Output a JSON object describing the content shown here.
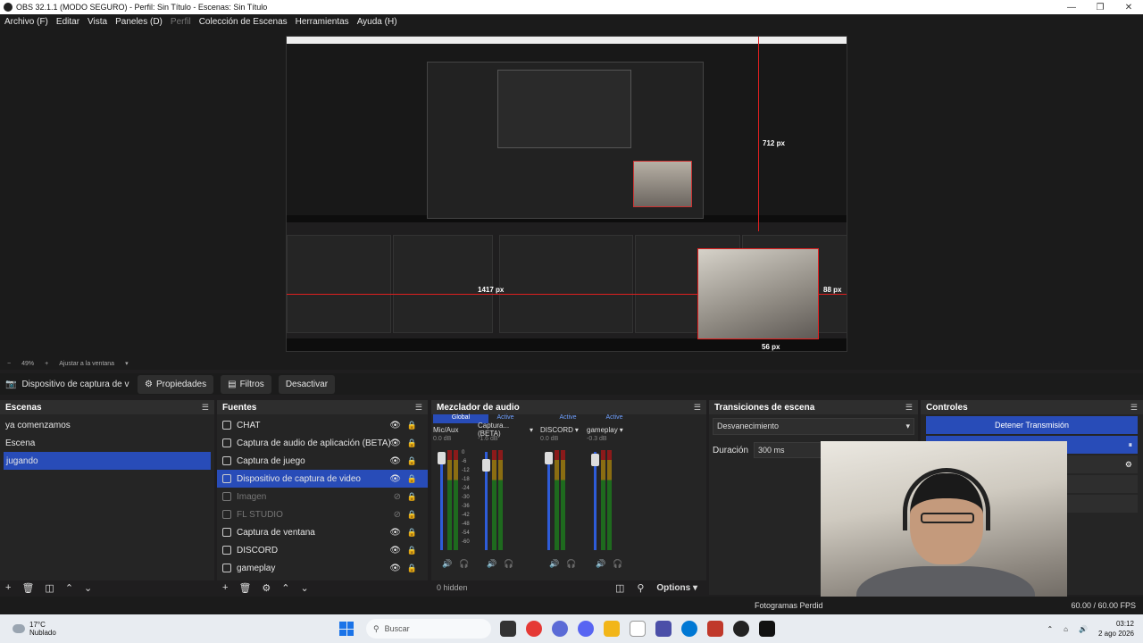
{
  "window": {
    "title": "OBS 32.1.1 (MODO SEGURO) - Perfil: Sin Título - Escenas: Sin Título",
    "minimize": "—",
    "maximize": "❐",
    "close": "✕"
  },
  "menu": [
    "Archivo (F)",
    "Editar",
    "Vista",
    "Paneles (D)",
    "Perfil",
    "Colección de Escenas",
    "Herramientas",
    "Ayuda (H)"
  ],
  "preview": {
    "measure_top": "712 px",
    "measure_left": "1417 px",
    "measure_right": "88 px",
    "measure_bottom": "56 px",
    "zoom": "49%",
    "zoom_fit": "Ajustar a la ventana"
  },
  "source_bar": {
    "selected_source": "Dispositivo de captura de v",
    "properties": "Propiedades",
    "filters": "Filtros",
    "deactivate": "Desactivar"
  },
  "scenes": {
    "title": "Escenas",
    "items": [
      "ya comenzamos",
      "Escena",
      "jugando"
    ],
    "selected_index": 2
  },
  "sources": {
    "title": "Fuentes",
    "items": [
      {
        "label": "CHAT",
        "icon": "globe-icon",
        "hidden": false
      },
      {
        "label": "Captura de audio de aplicación (BETA)",
        "icon": "window-icon",
        "hidden": false
      },
      {
        "label": "Captura de juego",
        "icon": "gamepad-icon",
        "hidden": false
      },
      {
        "label": "Dispositivo de captura de video",
        "icon": "camera-icon",
        "hidden": false
      },
      {
        "label": "Imagen",
        "icon": "image-icon",
        "hidden": true
      },
      {
        "label": "FL STUDIO",
        "icon": "window-icon",
        "hidden": true
      },
      {
        "label": "Captura de ventana",
        "icon": "window-icon",
        "hidden": false
      },
      {
        "label": "DISCORD",
        "icon": "window-icon",
        "hidden": false
      },
      {
        "label": "gameplay",
        "icon": "window-icon",
        "hidden": false
      }
    ],
    "selected_index": 3
  },
  "mixer": {
    "title": "Mezclador de audio",
    "channels": [
      {
        "status": "Global",
        "name": "Mic/Aux",
        "db": "0.0 dB"
      },
      {
        "status": "Active",
        "name": "Captura... (BETA)",
        "db": "-1.6 dB"
      },
      {
        "status": "Active",
        "name": "DISCORD",
        "db": "0.0 dB"
      },
      {
        "status": "Active",
        "name": "gameplay",
        "db": "-0.3 dB"
      }
    ],
    "scale": [
      "0",
      "-6",
      "-12",
      "-18",
      "-24",
      "-30",
      "-36",
      "-42",
      "-48",
      "-54",
      "-60"
    ],
    "hidden_count": "0 hidden",
    "options": "Options"
  },
  "transitions": {
    "title": "Transiciones de escena",
    "selected": "Desvanecimiento",
    "duration_label": "Duración",
    "duration_value": "300 ms"
  },
  "controls": {
    "title": "Controles",
    "stop_stream": "Detener Transmisión"
  },
  "status": {
    "dropped_frames": "Fotogramas Perdid",
    "fps": "60.00 / 60.00 FPS"
  },
  "taskbar": {
    "temperature": "17°C",
    "weather": "Nublado",
    "search": "Buscar",
    "time": "03:12",
    "date": "2 ago 2026"
  },
  "colors": {
    "accent": "#284cb8",
    "measure_line": "#e02020",
    "background": "#1f1e1f"
  }
}
